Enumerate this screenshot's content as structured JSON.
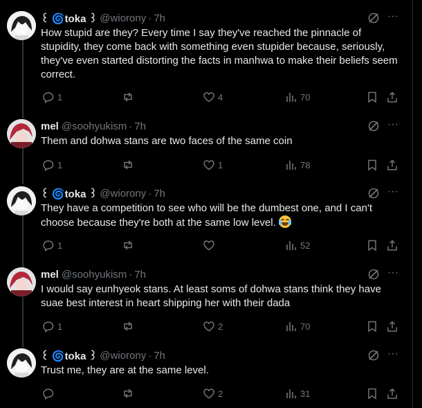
{
  "tweets": [
    {
      "author": "toka",
      "name": "꒰ 🌀toka ꒱",
      "handle": "@wiorony",
      "sep": "·",
      "time": "7h",
      "text": "How stupid are they? Every time I say they've reached the pinnacle of stupidity, they come back with something even stupider because, seriously, they've even started distorting the facts in manhwa to make their beliefs seem correct.",
      "replies": "1",
      "retweets": "",
      "likes": "4",
      "views": "70"
    },
    {
      "author": "mel",
      "name": "mel",
      "handle": "@soohyukism",
      "sep": "·",
      "time": "7h",
      "text": "Them and dohwa stans are two faces of the same coin",
      "replies": "1",
      "retweets": "",
      "likes": "1",
      "views": "78"
    },
    {
      "author": "toka",
      "name": "꒰ 🌀toka ꒱",
      "handle": "@wiorony",
      "sep": "·",
      "time": "7h",
      "text": "They have a competition to see who will be the dumbest one, and I can't choose because they're both at the same low level.",
      "emoji": "laughing-crying",
      "replies": "1",
      "retweets": "",
      "likes": "",
      "views": "52"
    },
    {
      "author": "mel",
      "name": "mel",
      "handle": "@soohyukism",
      "sep": "·",
      "time": "7h",
      "text": "I would say eunhyeok stans. At least soms of dohwa stans think they have suae best interest in heart shipping her with their dada",
      "replies": "1",
      "retweets": "",
      "likes": "2",
      "views": "70"
    },
    {
      "author": "toka",
      "name": "꒰ 🌀toka ꒱",
      "handle": "@wiorony",
      "sep": "·",
      "time": "7h",
      "text": "Trust me, they are at the same level.",
      "replies": "",
      "retweets": "",
      "likes": "2",
      "views": "31"
    }
  ],
  "icons": {
    "more": "more-icon",
    "grok": "grok-icon",
    "reply": "reply-icon",
    "retweet": "retweet-icon",
    "like": "like-icon",
    "views": "views-icon",
    "bookmark": "bookmark-icon",
    "share": "share-icon"
  },
  "colors": {
    "background": "#000000",
    "text": "#e7e9ea",
    "muted": "#71767b",
    "thread_line": "#333639"
  }
}
